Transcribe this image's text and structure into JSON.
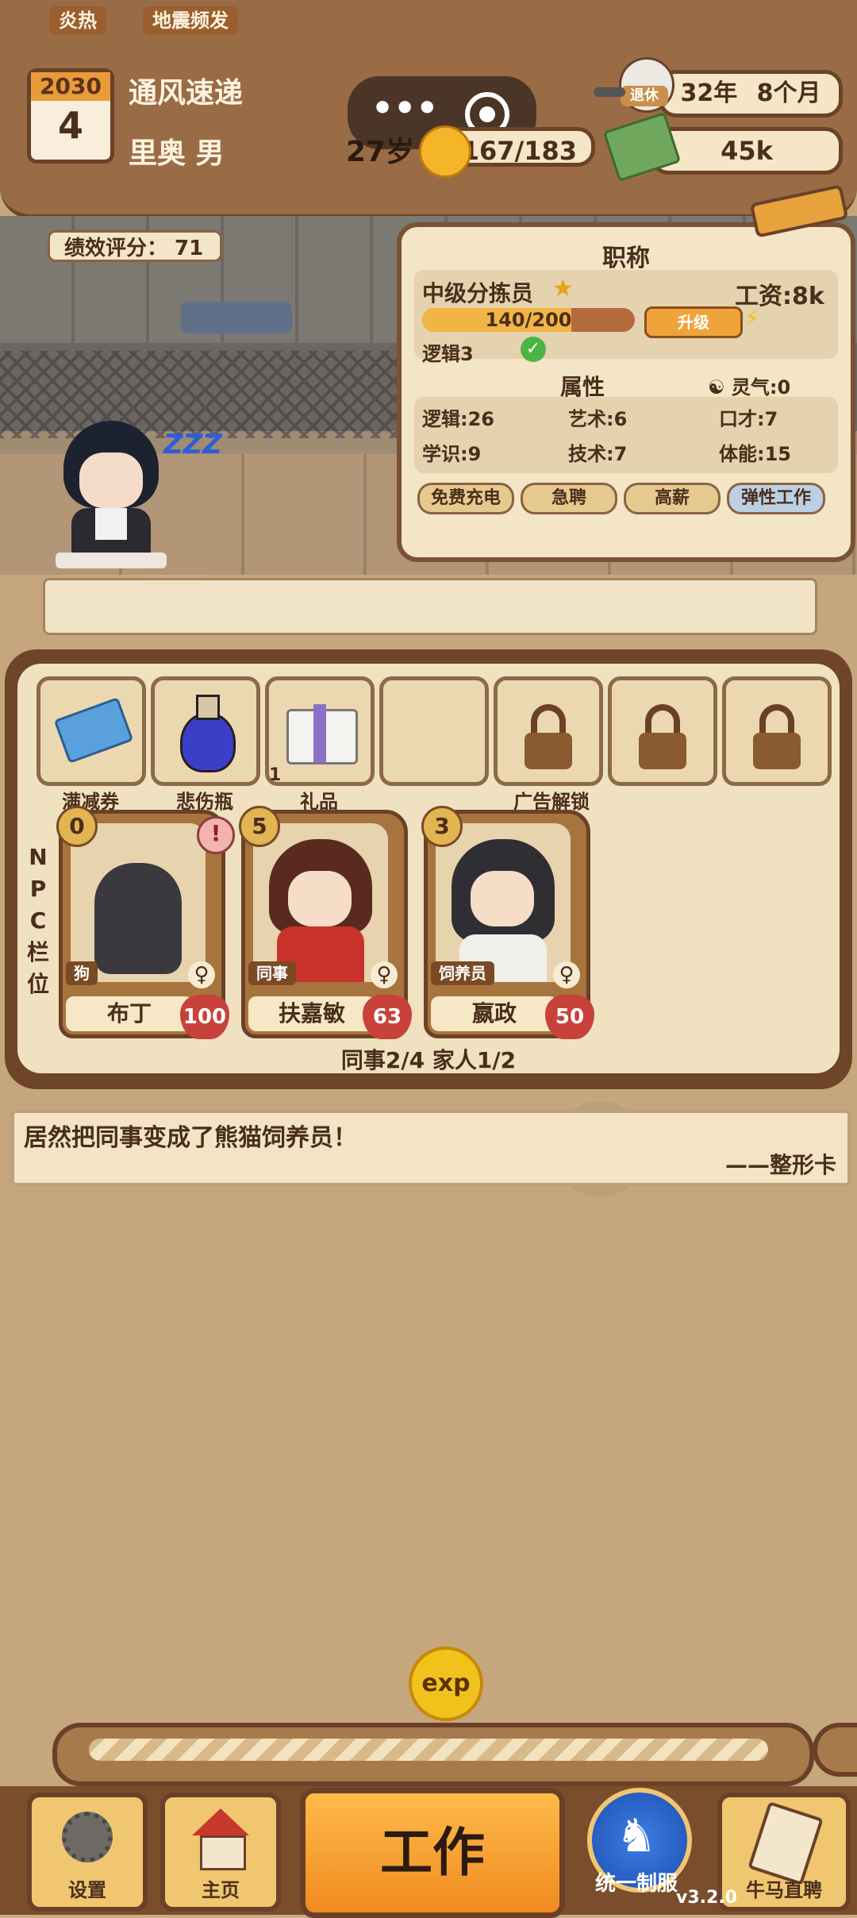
{
  "header": {
    "year": "2030",
    "month": "4",
    "company": "通风速递",
    "player": "里奥 男",
    "age": "27岁",
    "energy": "167/183",
    "retire_label": "退休",
    "retire_years": "32年",
    "retire_months": "8个月",
    "money": "45k",
    "menu_icon": "more-dots-icon",
    "target_icon": "record-icon"
  },
  "scene": {
    "performance_score": "绩效评分： 71",
    "sleep_text": "ZZZ"
  },
  "job": {
    "title_heading": "职称",
    "position": "中级分拣员",
    "salary": "工资:8k",
    "progress": "140/200",
    "progress_fraction": 0.7,
    "upgrade_label": "升级",
    "logic_req": "逻辑3",
    "attr_heading": "属性",
    "spirit": "灵气:0",
    "attrs": [
      "逻辑:26",
      "艺术:6",
      "口才:7",
      "学识:9",
      "技术:7",
      "体能:15"
    ],
    "tags": [
      "免费充电",
      "急聘",
      "高薪",
      "弹性工作"
    ]
  },
  "conditions": [
    "炎热",
    "地震频发"
  ],
  "inventory": {
    "slots": [
      {
        "label": "满减券",
        "icon": "coupon-icon",
        "count": ""
      },
      {
        "label": "悲伤瓶",
        "icon": "potion-icon",
        "count": ""
      },
      {
        "label": "礼品",
        "icon": "gift-icon",
        "count": "1"
      },
      {
        "label": "",
        "icon": "empty-slot",
        "count": ""
      },
      {
        "label": "广告解锁",
        "icon": "lock-icon",
        "count": ""
      },
      {
        "label": "",
        "icon": "lock-icon",
        "count": ""
      },
      {
        "label": "",
        "icon": "lock-icon",
        "count": ""
      }
    ]
  },
  "npc": {
    "side_label": "NPC栏位",
    "cards": [
      {
        "name": "布丁",
        "role": "狗",
        "level": "0",
        "affinity": "100",
        "gender": "♀"
      },
      {
        "name": "扶嘉敏",
        "role": "同事",
        "level": "5",
        "affinity": "63",
        "gender": "♀"
      },
      {
        "name": "嬴政",
        "role": "饲养员",
        "level": "3",
        "affinity": "50",
        "gender": "♀"
      }
    ],
    "summary": "同事2/4 家人1/2"
  },
  "quote": {
    "text": "居然把同事变成了熊猫饲养员！",
    "source": "——整形卡"
  },
  "bottom": {
    "exp_label": "exp",
    "settings": "设置",
    "home": "主页",
    "work": "工作",
    "uniform": "统一制服",
    "hire": "牛马直聘",
    "version": "v3.2.0"
  }
}
